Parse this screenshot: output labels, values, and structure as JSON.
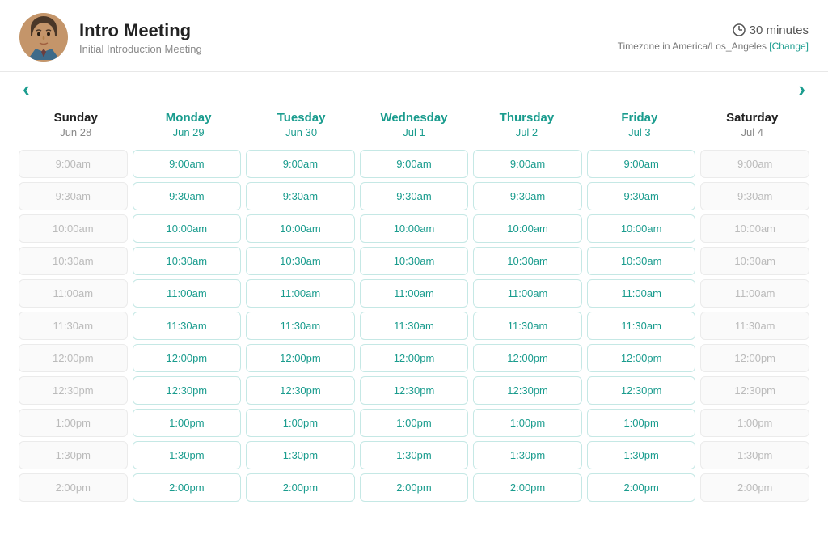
{
  "header": {
    "title": "Intro Meeting",
    "subtitle": "Initial Introduction Meeting",
    "duration": "30 minutes",
    "timezone_label": "Timezone in America/Los_Angeles",
    "change_label": "[Change]"
  },
  "nav": {
    "prev_label": "‹",
    "next_label": "›"
  },
  "days": [
    {
      "name": "Sunday",
      "date": "Jun 28",
      "active": false
    },
    {
      "name": "Monday",
      "date": "Jun 29",
      "active": true
    },
    {
      "name": "Tuesday",
      "date": "Jun 30",
      "active": true
    },
    {
      "name": "Wednesday",
      "date": "Jul 1",
      "active": true
    },
    {
      "name": "Thursday",
      "date": "Jul 2",
      "active": true
    },
    {
      "name": "Friday",
      "date": "Jul 3",
      "active": true
    },
    {
      "name": "Saturday",
      "date": "Jul 4",
      "active": false
    }
  ],
  "time_slots": [
    "9:00am",
    "9:30am",
    "10:00am",
    "10:30am",
    "11:00am",
    "11:30am",
    "12:00pm",
    "12:30pm",
    "1:00pm",
    "1:30pm",
    "2:00pm"
  ],
  "active_days_indices": [
    1,
    2,
    3,
    4,
    5
  ]
}
